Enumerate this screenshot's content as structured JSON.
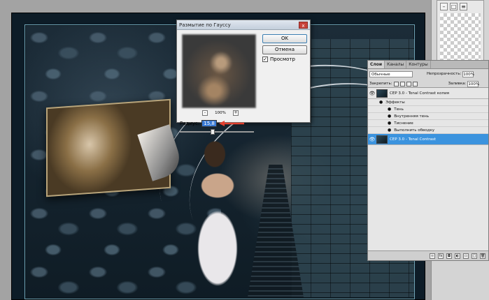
{
  "dialog": {
    "title": "Размытие по Гауссу",
    "close_symbol": "x",
    "ok_label": "OK",
    "cancel_label": "Отмена",
    "preview_label": "Просмотр",
    "preview_checked": true,
    "zoom_minus": "-",
    "zoom_value": "100%",
    "zoom_plus": "+",
    "radius_label": "Радиус:",
    "radius_value": "15,8"
  },
  "layers_panel": {
    "tabs": [
      "Слои",
      "Каналы",
      "Контуры"
    ],
    "blend_mode": "Обычные",
    "opacity_label": "Непрозрачность:",
    "opacity_value": "100%",
    "lock_label": "Закрепить:",
    "fill_label": "Заливка:",
    "fill_value": "100%",
    "layers": [
      {
        "name": "CEP 3.0 - Tonal Contrast копия",
        "active": false
      },
      {
        "name": "CEP 3.0 - Tonal Contrast",
        "active": true
      }
    ],
    "effects_label": "Эффекты",
    "effects": [
      "Тень",
      "Внутренняя тень",
      "Тиснение",
      "Выполнить обводку"
    ],
    "footer_fx": "fx"
  },
  "colors": {
    "accent_arrow": "#e2402f",
    "layer_selected": "#3b93de",
    "radius_highlight": "#3a7bd5"
  }
}
